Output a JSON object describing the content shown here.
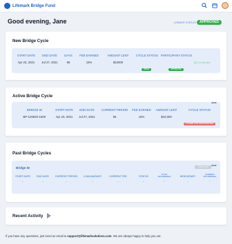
{
  "brand": {
    "name": "Lifemark Bridge Fund"
  },
  "header": {
    "greeting": "Good evening, Jane",
    "lender_status_label": "LENDER STATUS",
    "lender_status_value": "APPROVED"
  },
  "new_cycle": {
    "title": "New Bridge Cycle",
    "headers": [
      "START DATE",
      "END DATE",
      "DAYS",
      "FEE EARNED",
      "AMOUNT LENT",
      "CYCLE STATUS",
      "PARTICIPANT STATUS"
    ],
    "values": [
      "Apr 23, 2021",
      "Jul 27, 2021",
      "95",
      "15%",
      "$10000"
    ],
    "cycle_status": "OPEN",
    "participant_status": "APPROVED",
    "fully_allocated": "Full allocated"
  },
  "active_cycle": {
    "title": "Active Bridge Cycle",
    "headers": [
      "BRIDGE ID",
      "START DATE",
      "END DATE",
      "CURRENT PERIOD",
      "FEE EARNED",
      "AMOUNT LENT",
      "CYCLE STATUS"
    ],
    "values": [
      "BP-102820-150K",
      "Apr 23, 2021",
      "Jul 27, 2021",
      "95",
      "15%",
      "$10,000"
    ],
    "cycle_status": "CLOSED FOR PARTICIPATION",
    "more": "•••"
  },
  "past_cycles": {
    "title": "Past Bridge Cycles",
    "inner_title": "Bridge ID",
    "register_button": "+ REGISTER",
    "more": "•••",
    "headers": [
      "START DATE",
      "END DATE",
      "CURRENT PERIOD",
      "LOAN AMOUNT",
      "CURRENT FEE",
      "STATUS",
      "TOTAL WITHDRAWAL",
      "NEW MONEY",
      "CURRENT WITHDRAWAL"
    ],
    "values": [
      "-",
      "-",
      "-",
      "-",
      "-",
      "-",
      "-",
      "-",
      "-"
    ]
  },
  "recent_activity": {
    "title": "Recent Activity"
  },
  "footer": {
    "prefix": "If you have any questions, just send an email to ",
    "email": "support@lifemarksolutions.com",
    "suffix": ". We are always happy to help you out."
  },
  "colors": {
    "accent": "#2f66c9",
    "approved": "#33b04a",
    "closed": "#ef6767",
    "panel": "#e4edf9"
  },
  "icons": [
    "search-icon",
    "calendar-icon",
    "avatar",
    "check-circle-icon",
    "play-triangle-icon"
  ]
}
